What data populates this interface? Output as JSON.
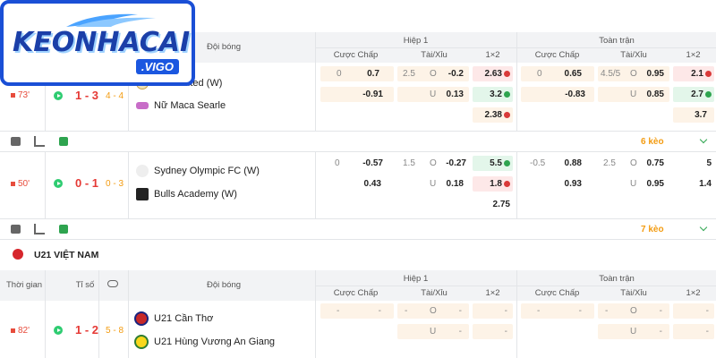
{
  "header": {
    "team_col": "Đội bóng",
    "half": "Hiệp 1",
    "full": "Toàn trận",
    "handicap": "Cược Chấp",
    "overunder": "Tài/Xỉu",
    "onextwo": "1×2"
  },
  "logo": {
    "main": "KEONHACAI",
    "sub": ".VIGO"
  },
  "match1": {
    "minute": "73'",
    "score": "1 - 3",
    "ht": "4 - 4",
    "home": "Hills United (W)",
    "away": "Nữ Maca Searle",
    "h1": {
      "hcap": [
        [
          "0",
          "0.7"
        ],
        [
          "",
          "-0.91"
        ]
      ],
      "ou": [
        [
          "2.5",
          "O",
          "-0.2"
        ],
        [
          "",
          "U",
          "0.13"
        ]
      ],
      "x12": [
        "2.63",
        "3.2",
        "2.38"
      ]
    },
    "ft": {
      "hcap": [
        [
          "0",
          "0.65"
        ],
        [
          "",
          "-0.83"
        ]
      ],
      "ou": [
        [
          "4.5/5",
          "O",
          "0.95"
        ],
        [
          "",
          "U",
          "0.85"
        ]
      ],
      "x12": [
        "2.1",
        "2.7",
        "3.7"
      ]
    },
    "keo": "6 kèo"
  },
  "match2": {
    "minute": "50'",
    "score": "0 - 1",
    "ht": "0 - 3",
    "home": "Sydney Olympic FC (W)",
    "away": "Bulls Academy (W)",
    "h1": {
      "hcap": [
        [
          "0",
          "-0.57"
        ],
        [
          "",
          "0.43"
        ]
      ],
      "ou": [
        [
          "1.5",
          "O",
          "-0.27"
        ],
        [
          "",
          "U",
          "0.18"
        ]
      ],
      "x12": [
        "5.5",
        "1.8",
        "2.75"
      ]
    },
    "ft": {
      "hcap": [
        [
          "-0.5",
          "0.88"
        ],
        [
          "",
          "0.93"
        ]
      ],
      "ou": [
        [
          "2.5",
          "O",
          "0.75"
        ],
        [
          "",
          "U",
          "0.95"
        ]
      ],
      "x12": [
        "5",
        "1.4",
        ""
      ]
    },
    "keo": "7 kèo"
  },
  "league2": {
    "name": "U21 VIỆT NAM",
    "time_col": "Thời gian",
    "score_col": "Tỉ số"
  },
  "match3": {
    "minute": "82'",
    "score": "1 - 2",
    "ht": "5 - 8",
    "home": "U21 Cần Thơ",
    "away": "U21 Hùng Vương An Giang",
    "h1": {
      "hcap": [
        "-",
        "-"
      ],
      "ou": [
        "-",
        "O",
        "-"
      ],
      "ou2": [
        "",
        "U",
        "-"
      ],
      "x12": [
        "-",
        "-"
      ]
    },
    "ft": {
      "hcap": [
        "-",
        "-"
      ],
      "ou": [
        "-",
        "O",
        "-"
      ],
      "ou2": [
        "",
        "U",
        "-"
      ],
      "x12": [
        "-",
        "-"
      ]
    }
  },
  "colors": {
    "accent_green": "#2ea44f",
    "accent_red": "#e53935",
    "accent_orange": "#f39c12"
  }
}
